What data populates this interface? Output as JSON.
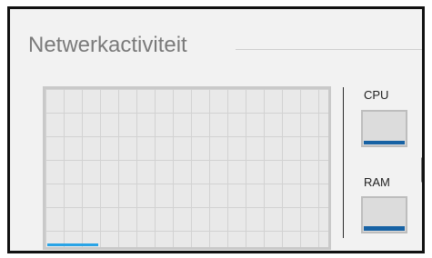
{
  "panel": {
    "title": "Netwerkactiviteit"
  },
  "network_graph": {
    "activity_fraction": 0.18,
    "line_color": "#2aa4e6"
  },
  "meters": [
    {
      "label": "CPU",
      "fill_fraction": 0.1,
      "color": "#1762a4"
    },
    {
      "label": "RAM",
      "fill_fraction": 0.15,
      "color": "#1762a4"
    }
  ],
  "icons": {
    "expand": "chevron-right-icon"
  }
}
